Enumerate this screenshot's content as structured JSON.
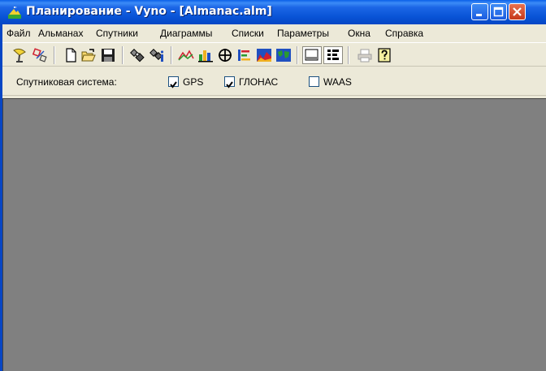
{
  "window": {
    "title": "Планирование - Vyno - [Almanac.alm]",
    "title_bar_color": "#0a5fe8",
    "close_color": "#c6391b"
  },
  "menu": {
    "items": [
      "Файл",
      "Альманах",
      "Спутники",
      "Диаграммы",
      "Списки",
      "Параметры",
      "Окна",
      "Справка"
    ]
  },
  "toolbar": {
    "icons": [
      {
        "name": "antenna-icon"
      },
      {
        "name": "satellite-select-icon"
      },
      {
        "name": "new-document-icon"
      },
      {
        "name": "open-folder-icon"
      },
      {
        "name": "save-icon"
      },
      {
        "name": "satellite-settings-icon"
      },
      {
        "name": "satellite-info-icon"
      },
      {
        "name": "elevation-chart-icon"
      },
      {
        "name": "bar-chart-icon"
      },
      {
        "name": "sky-plot-icon"
      },
      {
        "name": "visibility-list-icon"
      },
      {
        "name": "dop-chart-icon"
      },
      {
        "name": "world-map-icon"
      },
      {
        "name": "status-bar-toggle-icon"
      },
      {
        "name": "list-view-toggle-icon"
      },
      {
        "name": "print-icon"
      },
      {
        "name": "help-icon"
      }
    ]
  },
  "satellite_system": {
    "label": "Спутниковая система:",
    "options": [
      {
        "label": "GPS",
        "checked": true
      },
      {
        "label": "ГЛОНАС",
        "checked": true
      },
      {
        "label": "WAAS",
        "checked": false
      }
    ]
  },
  "client_area_color": "#808080"
}
